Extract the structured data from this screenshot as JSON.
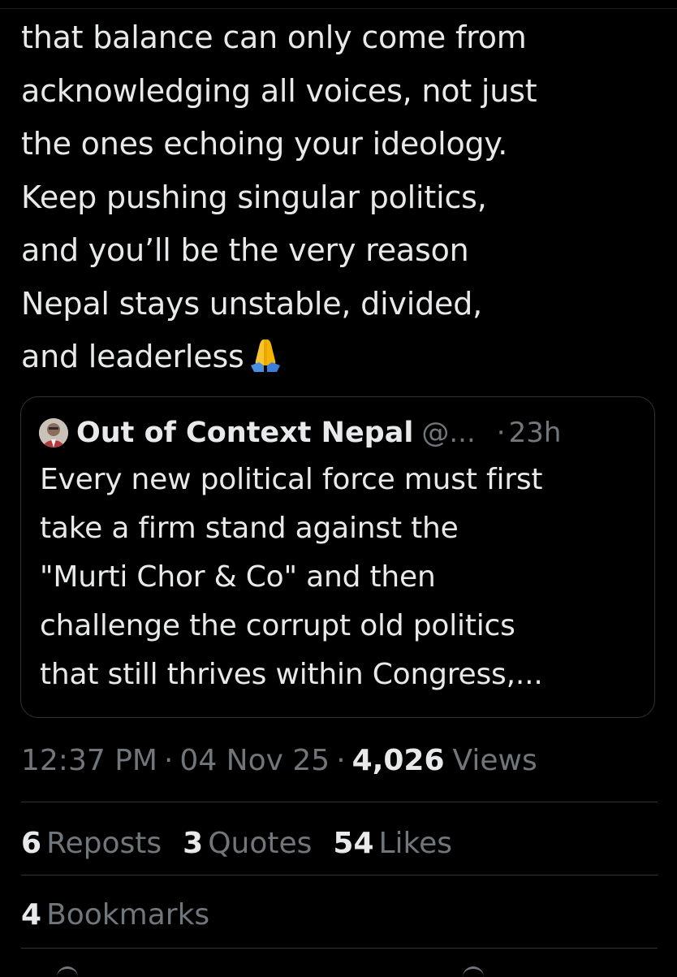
{
  "tweet": {
    "lines": [
      "that balance can only come from",
      "acknowledging all voices, not just",
      "the ones echoing your ideology.",
      "Keep pushing singular politics,",
      "and you’ll be the very reason",
      "Nepal stays unstable, divided,",
      "and leaderless"
    ],
    "emoji": "folded-hands-emoji"
  },
  "quote": {
    "name": "Out of Context Nepal",
    "handle": "@...",
    "separator": "·",
    "time": "23h",
    "lines": [
      "Every new political force must first",
      "take a firm stand against the",
      "\"Murti Chor & Co\" and then",
      "challenge the corrupt old politics",
      "that still thrives within Congress,..."
    ]
  },
  "meta": {
    "time": "12:37 PM",
    "date": "04 Nov 25",
    "views_count": "4,026",
    "views_label": "Views",
    "separator": "·"
  },
  "stats": {
    "reposts_count": "6",
    "reposts_label": "Reposts",
    "quotes_count": "3",
    "quotes_label": "Quotes",
    "likes_count": "54",
    "likes_label": "Likes",
    "bookmarks_count": "4",
    "bookmarks_label": "Bookmarks"
  },
  "colors": {
    "background": "#000000",
    "text": "#e7e9ea",
    "secondary": "#71767b",
    "border": "#2f3336"
  }
}
